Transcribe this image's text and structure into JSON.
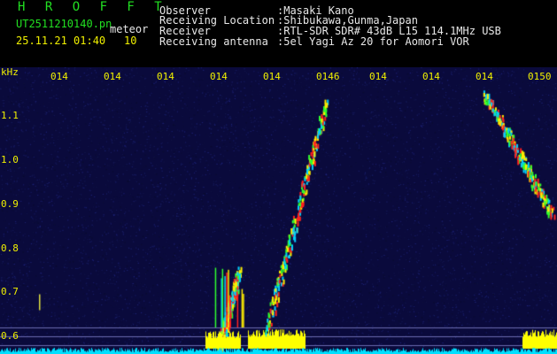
{
  "header": {
    "title": "H R O F F T",
    "file_name": "UT2511210140.pn",
    "mode": "meteor",
    "datetime": "25.11.21 01:40",
    "count": "10",
    "info_labels": [
      "Observer",
      "Receiving Location",
      "Receiver",
      "Receiving antenna"
    ],
    "info_values": [
      ":Masaki Kano",
      ":Shibukawa,Gunma,Japan",
      ":RTL-SDR SDR# 43dB L15 114.1MHz USB",
      ":5el Yagi Az 20 for Aomori VOR"
    ]
  },
  "chart_data": {
    "type": "heatmap",
    "ylabel": "kHz",
    "yticks": [
      "1.1",
      "1.0",
      "0.9",
      "0.8",
      "0.7",
      "0.6"
    ],
    "ylim": [
      0.6,
      1.1
    ],
    "xticks": [
      "014",
      "014",
      "014",
      "014",
      "014",
      "0146",
      "014",
      "014",
      "014",
      "0150"
    ],
    "background_color": "#0a0a3c",
    "trace_colors": [
      "#ff2020",
      "#ffee00",
      "#30ff30",
      "#00d0ff"
    ],
    "band_color": "#ffff00",
    "baseline_color": "#00e0ff",
    "traces": [
      {
        "start": [
          0.472,
          0.585
        ],
        "end": [
          0.585,
          1.13
        ],
        "count": 1
      },
      {
        "start": [
          0.392,
          0.57
        ],
        "end": [
          0.43,
          0.75
        ],
        "count": 1
      },
      {
        "start": [
          0.87,
          1.15
        ],
        "end": [
          0.99,
          0.88
        ],
        "count": 1
      }
    ]
  }
}
